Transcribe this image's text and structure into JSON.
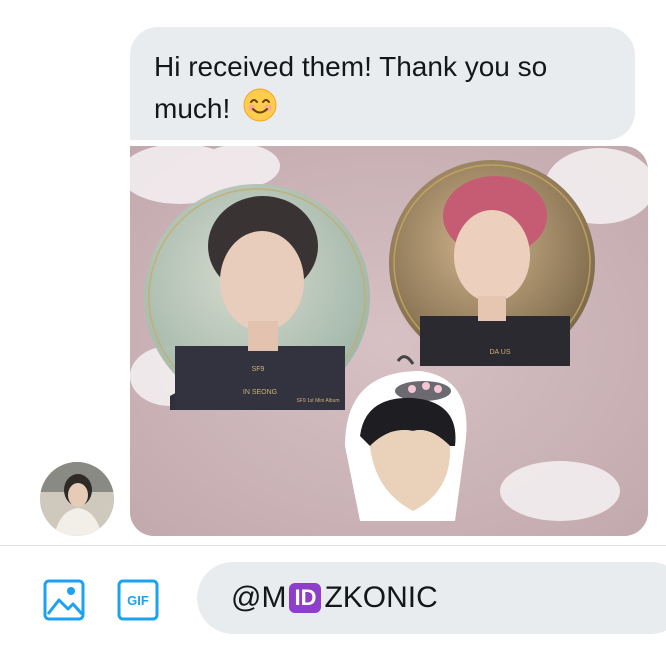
{
  "message": {
    "text": "Hi received them! Thank you so much!",
    "emoji": "smiling-face-emoji",
    "attachment": "photo-of-coasters-and-sticker"
  },
  "coasters": [
    {
      "caption": "IN SEONG",
      "tagline": "SF9 1st Mini Album"
    },
    {
      "caption": "DA US"
    }
  ],
  "avatar": "user-avatar",
  "composer": {
    "text_before": "@M",
    "badge": "ID",
    "text_after": "ZKONIC"
  },
  "toolbar": {
    "image_icon": "image-icon",
    "gif_label": "GIF"
  },
  "colors": {
    "bubble": "#e9ecef",
    "accent": "#1da1f2",
    "badge": "#8e3fc9"
  }
}
